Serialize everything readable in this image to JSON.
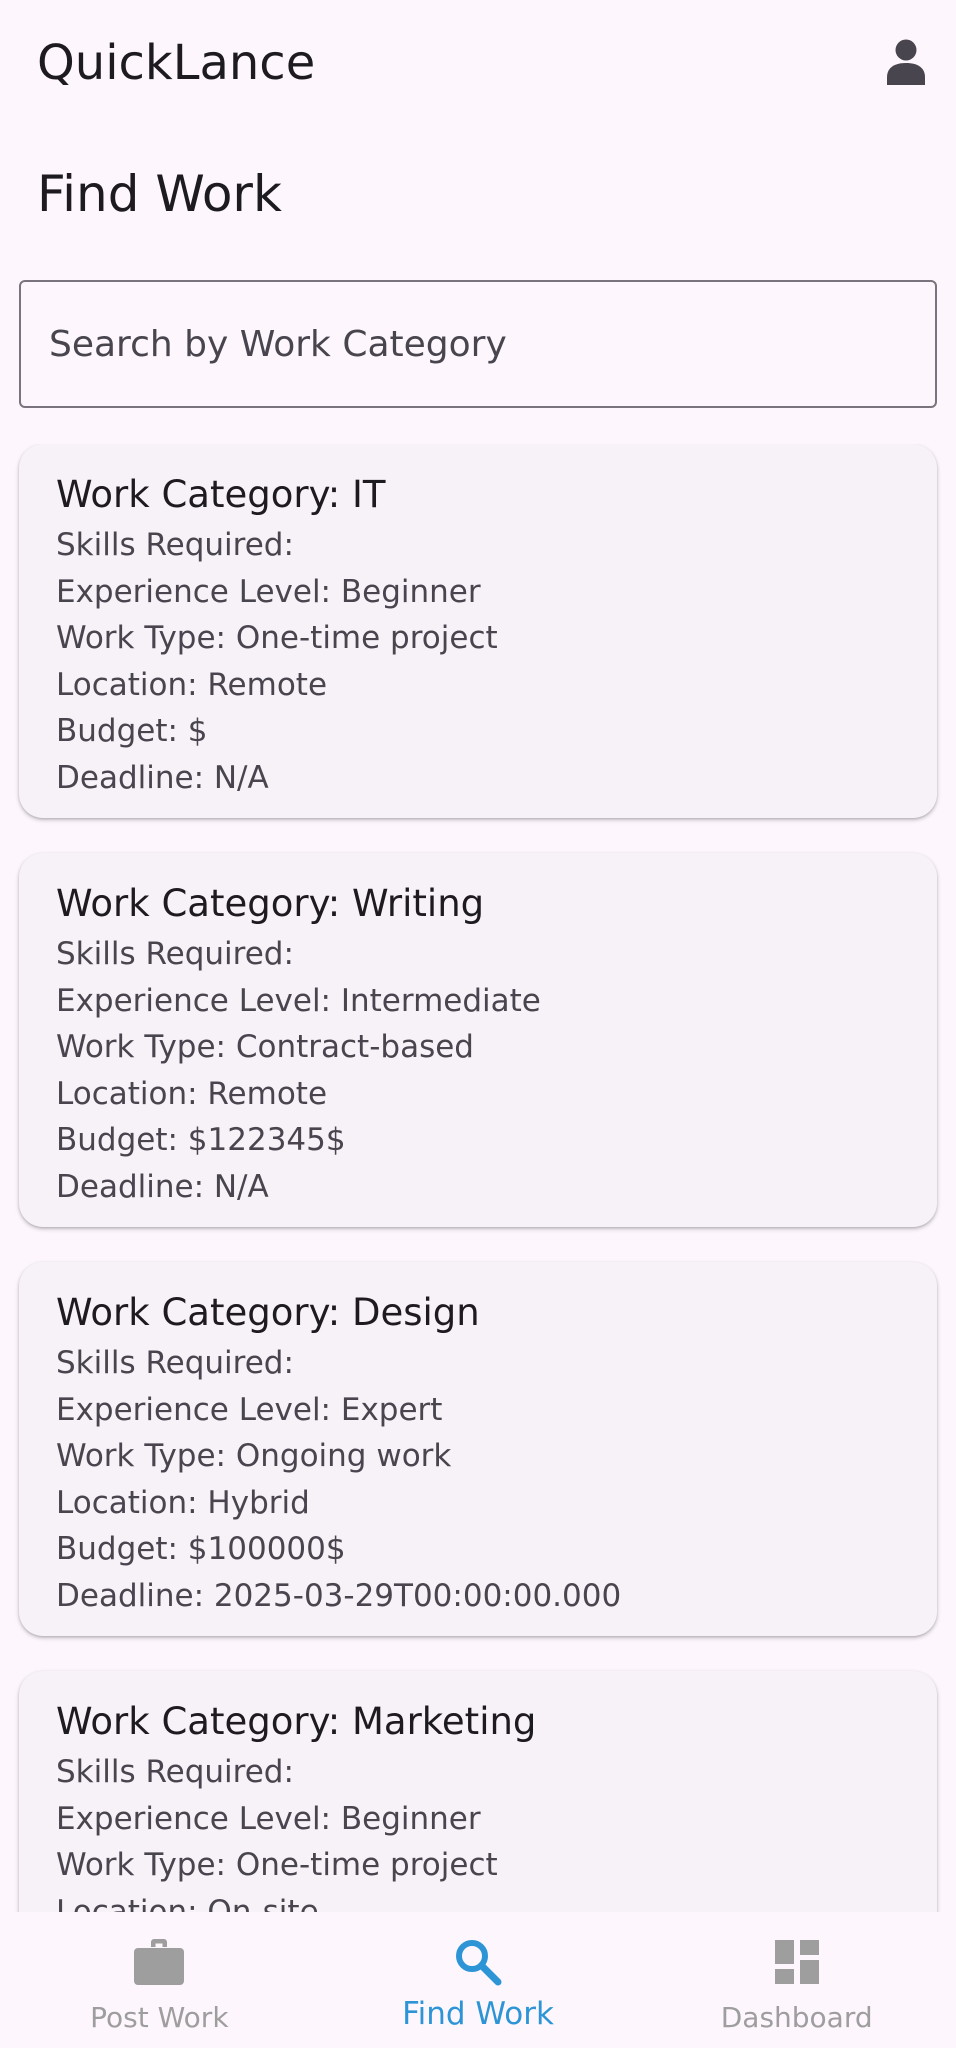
{
  "app": {
    "title": "QuickLance"
  },
  "page": {
    "title": "Find Work"
  },
  "search": {
    "placeholder": "Search by Work Category",
    "value": ""
  },
  "jobs": [
    {
      "category": "Work Category: IT",
      "skills": "Skills Required:",
      "experience": "Experience Level: Beginner",
      "work_type": "Work Type: One-time project",
      "location": "Location: Remote",
      "budget": "Budget: $",
      "deadline": "Deadline: N/A"
    },
    {
      "category": "Work Category: Writing",
      "skills": "Skills Required:",
      "experience": "Experience Level: Intermediate",
      "work_type": "Work Type: Contract-based",
      "location": "Location: Remote",
      "budget": "Budget: $122345$",
      "deadline": "Deadline: N/A"
    },
    {
      "category": "Work Category: Design",
      "skills": "Skills Required:",
      "experience": "Experience Level: Expert",
      "work_type": "Work Type: Ongoing work",
      "location": "Location: Hybrid",
      "budget": "Budget: $100000$",
      "deadline": "Deadline: 2025-03-29T00:00:00.000"
    },
    {
      "category": "Work Category: Marketing",
      "skills": "Skills Required:",
      "experience": "Experience Level: Beginner",
      "work_type": "Work Type: One-time project",
      "location": "Location: On-site"
    }
  ],
  "nav": {
    "items": [
      {
        "label": "Post Work",
        "icon": "briefcase-icon",
        "active": false
      },
      {
        "label": "Find Work",
        "icon": "search-icon",
        "active": true
      },
      {
        "label": "Dashboard",
        "icon": "dashboard-icon",
        "active": false
      }
    ]
  },
  "colors": {
    "background": "#fdf7fd",
    "card": "#f7f1f8",
    "accent": "#2d95d6",
    "inactive_nav": "#9e9e9e"
  }
}
